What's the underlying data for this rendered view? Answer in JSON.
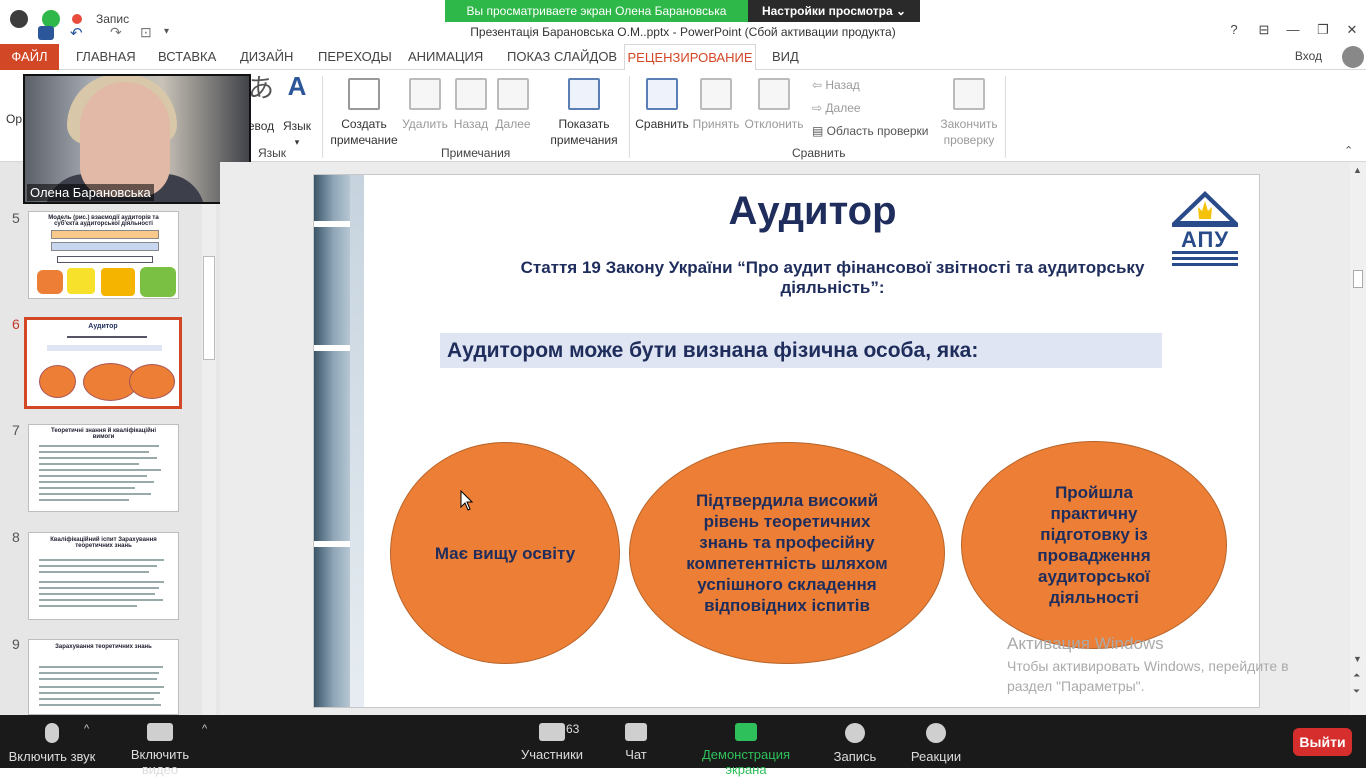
{
  "titlebar": {
    "doc_title": "Презентація Барановська О.М..pptx - PowerPoint (Сбой активации продукта)",
    "share_banner": "Вы просматриваете экран Олена Барановська",
    "view_options": "Настройки просмотра ⌄",
    "recording_label": "Запис",
    "help": "?",
    "minimize": "—",
    "restore": "❐",
    "close": "✕"
  },
  "menu": {
    "tabs": [
      "ФАЙЛ",
      "ГЛАВНАЯ",
      "ВСТАВКА",
      "ДИЗАЙН",
      "ПЕРЕХОДЫ",
      "АНИМАЦИЯ",
      "ПОКАЗ СЛАЙДОВ",
      "РЕЦЕНЗИРОВАНИЕ",
      "ВИД"
    ],
    "login": "Вход"
  },
  "ribbon": {
    "partial_left": "Ор",
    "translate_partial": "евод",
    "language": "Язык",
    "new_comment": "Создать примечание",
    "delete": "Удалить",
    "prev": "Назад",
    "next": "Далее",
    "show_comments": "Показать примечания",
    "compare": "Сравнить",
    "accept": "Принять",
    "reject": "Отклонить",
    "small_prev": "Назад",
    "small_next": "Далее",
    "review_pane": "Область проверки",
    "end_review": "Закончить проверку",
    "groups": {
      "language": "Язык",
      "comments": "Примечания",
      "compare": "Сравнить"
    }
  },
  "video": {
    "name": "Олена Барановська"
  },
  "thumbnails": [
    {
      "num": "5",
      "title": "Модель (рис.) взаємодії аудиторів та суб'єкта аудиторської діяльності"
    },
    {
      "num": "6",
      "title": "Аудитор"
    },
    {
      "num": "7",
      "title": "Теоретичні знання й кваліфікаційні вимоги"
    },
    {
      "num": "8",
      "title": "Кваліфікаційний іспит Зарахування теоретичних знань"
    },
    {
      "num": "9",
      "title": "Зарахування теоретичних знань"
    }
  ],
  "slide": {
    "title": "Аудитор",
    "subtitle": "Стаття 19 Закону України “Про аудит фінансової звітності та аудиторську діяльність”:",
    "band": "Аудитором може бути визнана фізична особа, яка:",
    "ovals": [
      "Має вищу освіту",
      "Підтвердила високий рівень теоретичних знань та професійну компетентність шляхом успішного складення відповідних іспитів",
      "Пройшла практичну підготовку із провадження аудиторської діяльності"
    ],
    "logo_text": "АПУ"
  },
  "watermark": {
    "title": "Активация Windows",
    "text": "Чтобы активировать Windows, перейдите в раздел \"Параметры\"."
  },
  "zoom": {
    "unmute": "Включить звук",
    "video": "Включить видео",
    "participants": "Участники",
    "participants_count": "63",
    "chat": "Чат",
    "share": "Демонстрация экрана",
    "record": "Запись",
    "reactions": "Реакции",
    "leave": "Выйти"
  }
}
